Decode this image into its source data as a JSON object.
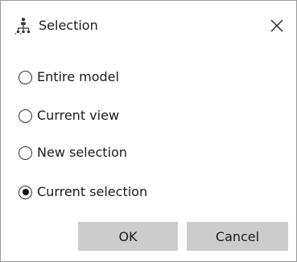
{
  "dialog": {
    "title": "Selection",
    "title_icon": "hierarchy-selection-icon",
    "close_icon": "close-icon"
  },
  "options": [
    {
      "label": "Entire model",
      "checked": false
    },
    {
      "label": "Current view",
      "checked": false
    },
    {
      "label": "New selection",
      "checked": false
    },
    {
      "label": "Current selection",
      "checked": true
    }
  ],
  "buttons": {
    "ok_label": "OK",
    "cancel_label": "Cancel"
  },
  "colors": {
    "button_bg": "#cccccc",
    "border": "#9a9a9a"
  }
}
